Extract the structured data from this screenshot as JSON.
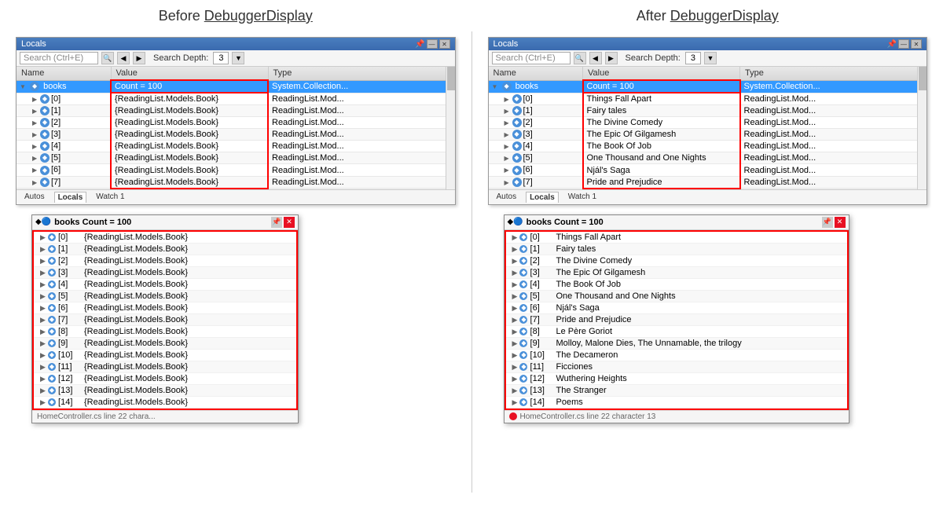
{
  "left_title": "Before ",
  "left_title_underline": "DebuggerDisplay",
  "right_title": "After ",
  "right_title_underline": "DebuggerDisplay",
  "debugger": {
    "window_title": "Locals",
    "search_placeholder": "Search (Ctrl+E)",
    "search_depth_label": "Search Depth:",
    "search_depth_value": "3",
    "columns": {
      "name": "Name",
      "value": "Value",
      "type": "Type"
    },
    "footer_tabs": [
      "Autos",
      "Locals",
      "Watch 1"
    ]
  },
  "before_top": {
    "books_row": {
      "name": "books",
      "value": "Count = 100",
      "type": "System.Collection..."
    },
    "items": [
      {
        "index": "[0]",
        "value": "{ReadingList.Models.Book}",
        "type": "ReadingList.Mod..."
      },
      {
        "index": "[1]",
        "value": "{ReadingList.Models.Book}",
        "type": "ReadingList.Mod..."
      },
      {
        "index": "[2]",
        "value": "{ReadingList.Models.Book}",
        "type": "ReadingList.Mod..."
      },
      {
        "index": "[3]",
        "value": "{ReadingList.Models.Book}",
        "type": "ReadingList.Mod..."
      },
      {
        "index": "[4]",
        "value": "{ReadingList.Models.Book}",
        "type": "ReadingList.Mod..."
      },
      {
        "index": "[5]",
        "value": "{ReadingList.Models.Book}",
        "type": "ReadingList.Mod..."
      },
      {
        "index": "[6]",
        "value": "{ReadingList.Models.Book}",
        "type": "ReadingList.Mod..."
      },
      {
        "index": "[7]",
        "value": "{ReadingList.Models.Book}",
        "type": "ReadingList.Mod..."
      }
    ]
  },
  "after_top": {
    "books_row": {
      "name": "books",
      "value": "Count = 100",
      "type": "System.Collection..."
    },
    "items": [
      {
        "index": "[0]",
        "value": "Things Fall Apart",
        "type": "ReadingList.Mod..."
      },
      {
        "index": "[1]",
        "value": "Fairy tales",
        "type": "ReadingList.Mod..."
      },
      {
        "index": "[2]",
        "value": "The Divine Comedy",
        "type": "ReadingList.Mod..."
      },
      {
        "index": "[3]",
        "value": "The Epic Of Gilgamesh",
        "type": "ReadingList.Mod..."
      },
      {
        "index": "[4]",
        "value": "The Book Of Job",
        "type": "ReadingList.Mod..."
      },
      {
        "index": "[5]",
        "value": "One Thousand and One Nights",
        "type": "ReadingList.Mod..."
      },
      {
        "index": "[6]",
        "value": "Njál's Saga",
        "type": "ReadingList.Mod..."
      },
      {
        "index": "[7]",
        "value": "Pride and Prejudice",
        "type": "ReadingList.Mod..."
      }
    ]
  },
  "before_tooltip": {
    "title": "books  Count = 100",
    "items": [
      {
        "index": "[0]",
        "value": "{ReadingList.Models.Book}"
      },
      {
        "index": "[1]",
        "value": "{ReadingList.Models.Book}"
      },
      {
        "index": "[2]",
        "value": "{ReadingList.Models.Book}"
      },
      {
        "index": "[3]",
        "value": "{ReadingList.Models.Book}"
      },
      {
        "index": "[4]",
        "value": "{ReadingList.Models.Book}"
      },
      {
        "index": "[5]",
        "value": "{ReadingList.Models.Book}"
      },
      {
        "index": "[6]",
        "value": "{ReadingList.Models.Book}"
      },
      {
        "index": "[7]",
        "value": "{ReadingList.Models.Book}"
      },
      {
        "index": "[8]",
        "value": "{ReadingList.Models.Book}"
      },
      {
        "index": "[9]",
        "value": "{ReadingList.Models.Book}"
      },
      {
        "index": "[10]",
        "value": "{ReadingList.Models.Book}"
      },
      {
        "index": "[11]",
        "value": "{ReadingList.Models.Book}"
      },
      {
        "index": "[12]",
        "value": "{ReadingList.Models.Book}"
      },
      {
        "index": "[13]",
        "value": "{ReadingList.Models.Book}"
      },
      {
        "index": "[14]",
        "value": "{ReadingList.Models.Book}"
      }
    ],
    "footer": "HomeController.cs line 22 chara..."
  },
  "after_tooltip": {
    "title": "books  Count = 100",
    "items": [
      {
        "index": "[0]",
        "value": "Things Fall Apart"
      },
      {
        "index": "[1]",
        "value": "Fairy tales"
      },
      {
        "index": "[2]",
        "value": "The Divine Comedy"
      },
      {
        "index": "[3]",
        "value": "The Epic Of Gilgamesh"
      },
      {
        "index": "[4]",
        "value": "The Book Of Job"
      },
      {
        "index": "[5]",
        "value": "One Thousand and One Nights"
      },
      {
        "index": "[6]",
        "value": "Njál's Saga"
      },
      {
        "index": "[7]",
        "value": "Pride and Prejudice"
      },
      {
        "index": "[8]",
        "value": "Le Père Goriot"
      },
      {
        "index": "[9]",
        "value": "Molloy, Malone Dies, The Unnamable, the trilogy"
      },
      {
        "index": "[10]",
        "value": "The Decameron"
      },
      {
        "index": "[11]",
        "value": "Ficciones"
      },
      {
        "index": "[12]",
        "value": "Wuthering Heights"
      },
      {
        "index": "[13]",
        "value": "The Stranger"
      },
      {
        "index": "[14]",
        "value": "Poems"
      }
    ],
    "footer": "HomeController.cs line 22 character 13"
  }
}
